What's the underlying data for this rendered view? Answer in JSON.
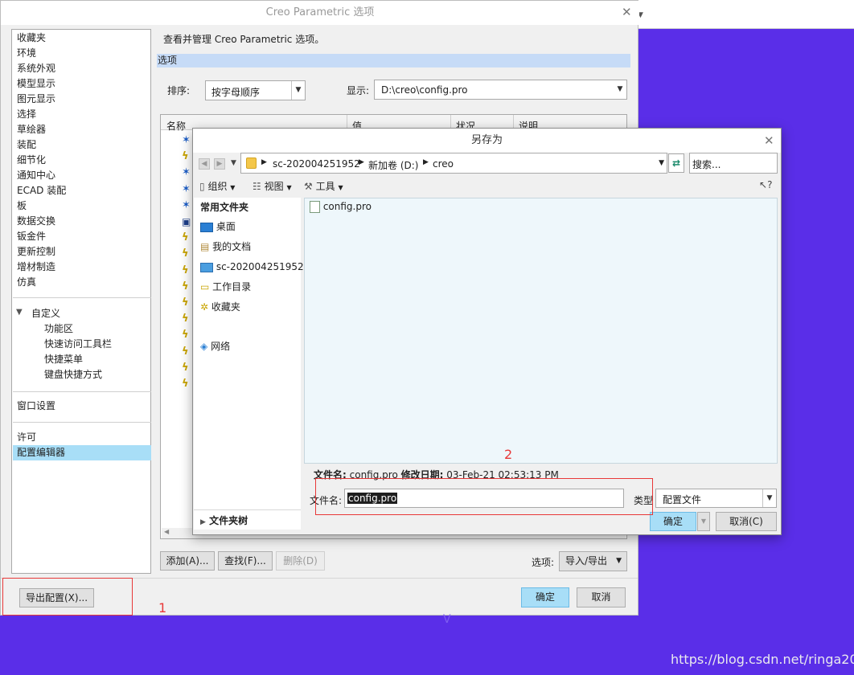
{
  "options_window": {
    "title": "Creo Parametric 选项",
    "description": "查看并管理 Creo Parametric 选项。",
    "section_header": "选项",
    "nav_items": [
      "收藏夹",
      "环境",
      "系统外观",
      "模型显示",
      "图元显示",
      "选择",
      "草绘器",
      "装配",
      "细节化",
      "通知中心",
      "ECAD 装配",
      "板",
      "数据交换",
      "钣金件",
      "更新控制",
      "增材制造",
      "仿真"
    ],
    "customize_header": "自定义",
    "customize_items": [
      "功能区",
      "快速访问工具栏",
      "快捷菜单",
      "键盘快捷方式"
    ],
    "window_settings": "窗口设置",
    "license": "许可",
    "config_editor": "配置编辑器",
    "sort_label": "排序:",
    "sort_value": "按字母顺序",
    "show_label": "显示:",
    "show_value": "D:\\creo\\config.pro",
    "columns": [
      "名称",
      "值",
      "状况",
      "说明"
    ],
    "add_button": "添加(A)...",
    "find_button": "查找(F)...",
    "delete_button": "删除(D)",
    "options_label": "选项:",
    "import_export": "导入/导出",
    "export_config_button": "导出配置(X)...",
    "ok_button": "确定",
    "cancel_button": "取消"
  },
  "save_as_dialog": {
    "title": "另存为",
    "breadcrumb": [
      "sc-202004251952",
      "新加卷 (D:)",
      "creo"
    ],
    "search_placeholder": "搜索...",
    "toolbar": {
      "organize": "组织",
      "views": "视图",
      "tools": "工具"
    },
    "help_icon_label": "?",
    "sidebar_header": "常用文件夹",
    "sidebar_items": [
      "桌面",
      "我的文档",
      "sc-202004251952",
      "工作目录",
      "收藏夹",
      "网络"
    ],
    "folder_tree": "文件夹树",
    "file_list": [
      "config.pro"
    ],
    "file_info_name_label": "文件名:",
    "file_info_name": "config.pro",
    "file_info_date_label": "修改日期:",
    "file_info_date": "03-Feb-21 02:53:13 PM",
    "filename_label": "文件名:",
    "filename_value": "config.pro",
    "type_label": "类型",
    "type_value": "配置文件",
    "ok_button": "确定",
    "cancel_button": "取消(C)"
  },
  "annotations": {
    "num1": "1",
    "num2": "2"
  },
  "watermark": "https://blog.csdn.net/ringa2015",
  "stray_glyph": "V",
  "colors": {
    "background": "#5a2ee8",
    "selection": "#a8def7",
    "annotation": "#e83838"
  }
}
